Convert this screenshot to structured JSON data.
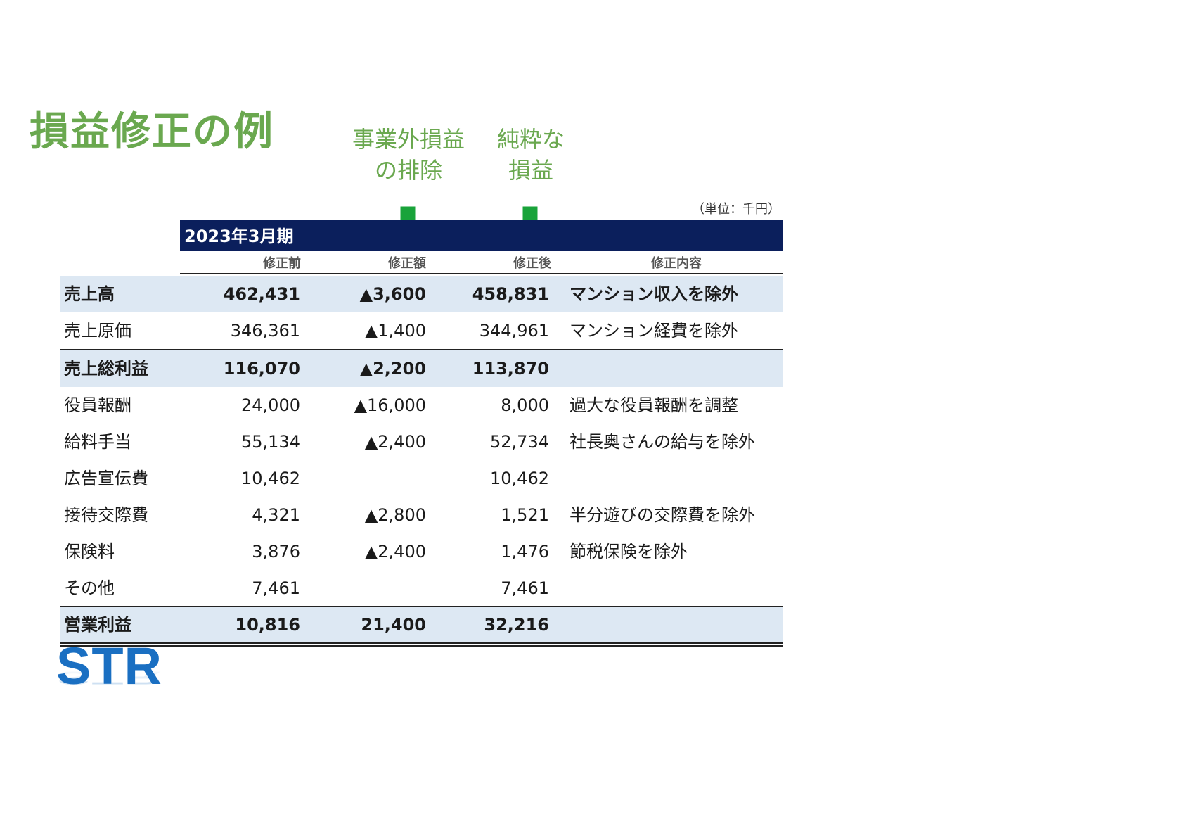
{
  "title": "損益修正の例",
  "notes": {
    "exclusion": [
      "事業外損益",
      "の排除"
    ],
    "pure": [
      "純粋な",
      "損益"
    ]
  },
  "unit": "（単位：千円）",
  "period": "2023年3月期",
  "columns": [
    "修正前",
    "修正額",
    "修正後",
    "修正内容"
  ],
  "rows": [
    {
      "label": "売上高",
      "before": "462,431",
      "adjust": "▲3,600",
      "after": "458,831",
      "note": "マンション収入を除外"
    },
    {
      "label": "売上原価",
      "before": "346,361",
      "adjust": "▲1,400",
      "after": "344,961",
      "note": "マンション経費を除外"
    },
    {
      "label": "売上総利益",
      "before": "116,070",
      "adjust": "▲2,200",
      "after": "113,870",
      "note": ""
    },
    {
      "label": "役員報酬",
      "before": "24,000",
      "adjust": "▲16,000",
      "after": "8,000",
      "note": "過大な役員報酬を調整"
    },
    {
      "label": "給料手当",
      "before": "55,134",
      "adjust": "▲2,400",
      "after": "52,734",
      "note": "社長奥さんの給与を除外"
    },
    {
      "label": "広告宣伝費",
      "before": "10,462",
      "adjust": "",
      "after": "10,462",
      "note": ""
    },
    {
      "label": "接待交際費",
      "before": "4,321",
      "adjust": "▲2,800",
      "after": "1,521",
      "note": "半分遊びの交際費を除外"
    },
    {
      "label": "保険料",
      "before": "3,876",
      "adjust": "▲2,400",
      "after": "1,476",
      "note": "節税保険を除外"
    },
    {
      "label": "その他",
      "before": "7,461",
      "adjust": "",
      "after": "7,461",
      "note": ""
    },
    {
      "label": "営業利益",
      "before": "10,816",
      "adjust": "21,400",
      "after": "32,216",
      "note": ""
    }
  ],
  "logo": "STR",
  "colors": {
    "accent_green": "#6aa84f",
    "arrow_green": "#19a33a",
    "header_navy": "#0b1f5c",
    "highlight_row": "#dde8f3",
    "logo_blue": "#1a6fc2"
  }
}
